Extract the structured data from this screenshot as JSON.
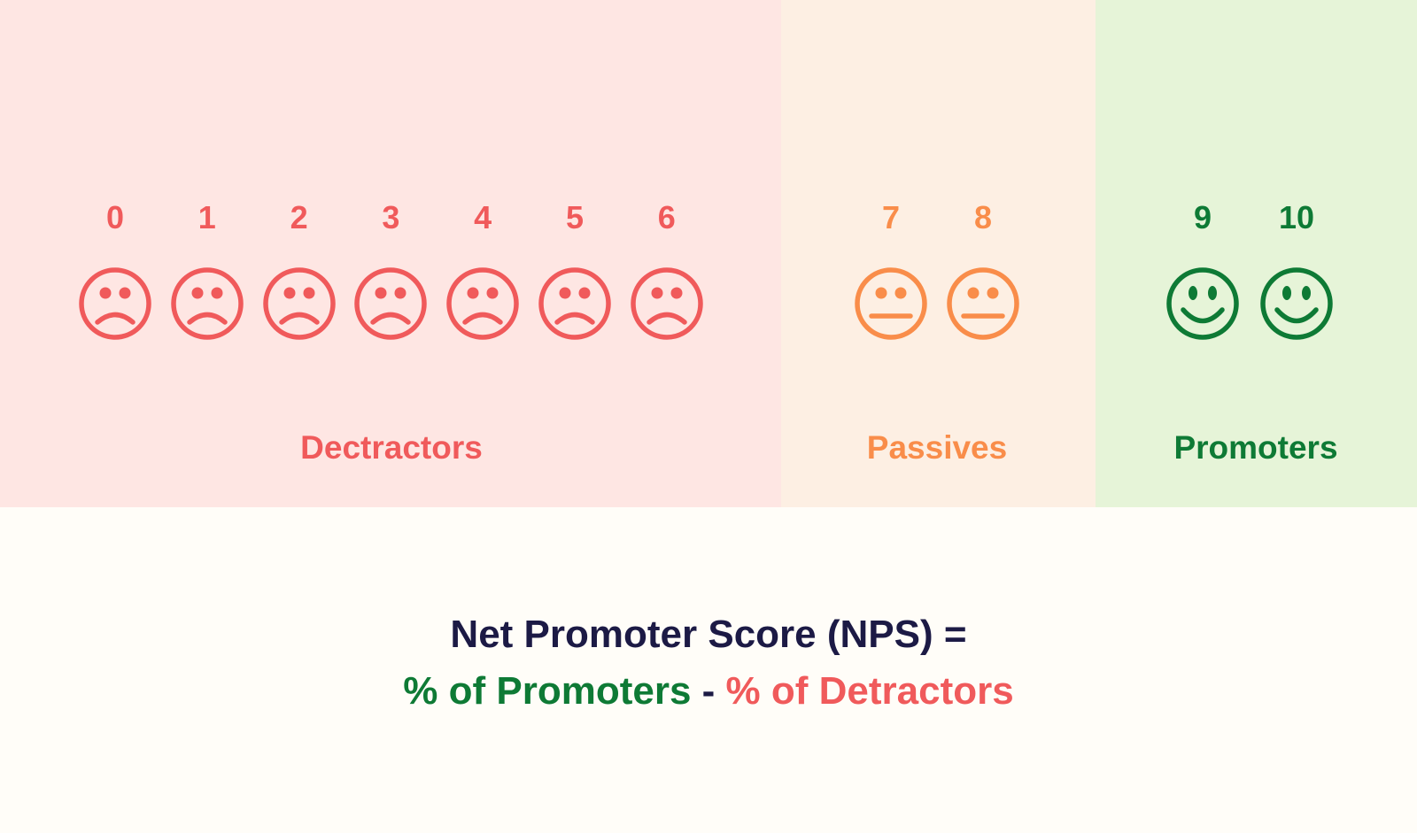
{
  "colors": {
    "detractor": "#f05a5b",
    "passive": "#f98d4a",
    "promoter": "#0e7a35",
    "formula_dark": "#1c1a45",
    "detractor_bg": "#fee6e3",
    "passive_bg": "#fdefe3",
    "promoter_bg": "#e6f4d8",
    "page_bg": "#fffdf8"
  },
  "groups": {
    "detractors": {
      "label": "Dectractors",
      "scores": [
        "0",
        "1",
        "2",
        "3",
        "4",
        "5",
        "6"
      ],
      "face": "sad-face-icon"
    },
    "passives": {
      "label": "Passives",
      "scores": [
        "7",
        "8"
      ],
      "face": "neutral-face-icon"
    },
    "promoters": {
      "label": "Promoters",
      "scores": [
        "9",
        "10"
      ],
      "face": "happy-face-icon"
    }
  },
  "formula": {
    "line1": "Net Promoter Score (NPS) =",
    "promoters_term": "% of Promoters",
    "operator": " - ",
    "detractors_term": "% of Detractors"
  }
}
